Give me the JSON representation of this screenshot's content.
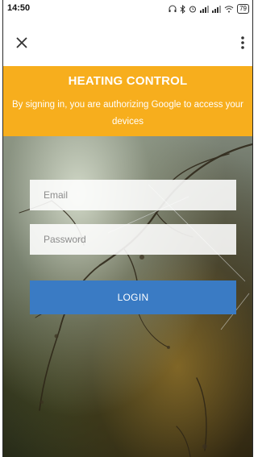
{
  "status_bar": {
    "time": "14:50",
    "battery": "79",
    "icons": [
      "headset-icon",
      "bluetooth-icon",
      "alarm-icon",
      "signal-icon",
      "signal-icon",
      "wifi-icon",
      "battery-icon"
    ]
  },
  "app_bar": {
    "close_icon": "close-icon",
    "menu_icon": "more-vert-icon"
  },
  "banner": {
    "title": "HEATING CONTROL",
    "subtitle": "By signing in, you are authorizing Google to access your devices",
    "color": "#f7ae1d"
  },
  "form": {
    "email_placeholder": "Email",
    "email_value": "",
    "password_placeholder": "Password",
    "password_value": "",
    "login_label": "LOGIN",
    "login_color": "#3a7bc4"
  }
}
